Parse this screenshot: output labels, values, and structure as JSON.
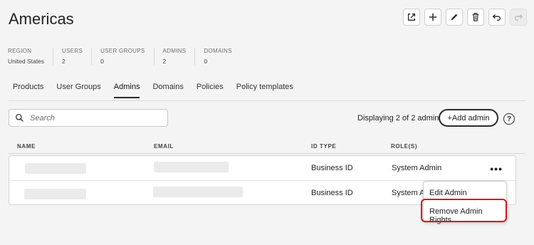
{
  "title": "Americas",
  "toolbar": [
    {
      "name": "open-external-icon"
    },
    {
      "name": "add-icon"
    },
    {
      "name": "edit-pencil-icon"
    },
    {
      "name": "delete-trash-icon"
    },
    {
      "name": "undo-icon"
    },
    {
      "name": "redo-icon"
    }
  ],
  "stats": [
    {
      "label": "REGION",
      "value": "United States"
    },
    {
      "label": "USERS",
      "value": "2"
    },
    {
      "label": "USER GROUPS",
      "value": "0"
    },
    {
      "label": "ADMINS",
      "value": "2"
    },
    {
      "label": "DOMAINS",
      "value": "0"
    }
  ],
  "tabs": [
    {
      "label": "Products"
    },
    {
      "label": "User Groups"
    },
    {
      "label": "Admins",
      "active": true
    },
    {
      "label": "Domains"
    },
    {
      "label": "Policies"
    },
    {
      "label": "Policy templates"
    }
  ],
  "search": {
    "placeholder": "Search"
  },
  "display_count": "Displaying 2 of 2 admins",
  "add_admin_label": "+Add admin",
  "help_label": "?",
  "table": {
    "headers": {
      "name": "NAME",
      "email": "EMAIL",
      "id_type": "ID TYPE",
      "roles": "ROLE(S)"
    },
    "rows": [
      {
        "id_type": "Business ID",
        "role": "System Admin",
        "more": "•••"
      },
      {
        "id_type": "Business ID",
        "role": "System Ac"
      }
    ]
  },
  "menu": {
    "edit": "Edit Admin",
    "remove": "Remove Admin Rights"
  },
  "colors": {
    "highlight": "#d7141c",
    "text": "#2c2c2c"
  }
}
